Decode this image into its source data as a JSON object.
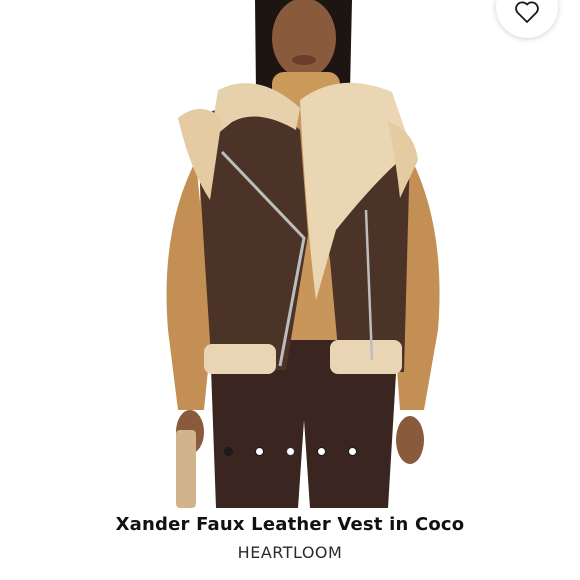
{
  "product": {
    "title": "Xander Faux Leather Vest in Coco",
    "brand": "HEARTLOOM"
  },
  "gallery": {
    "image_count": 5,
    "active_index": 0
  },
  "icons": {
    "favorite": "heart-outline-icon"
  },
  "colors": {
    "text": "#111111",
    "dot_active": "#1a1a1a"
  }
}
